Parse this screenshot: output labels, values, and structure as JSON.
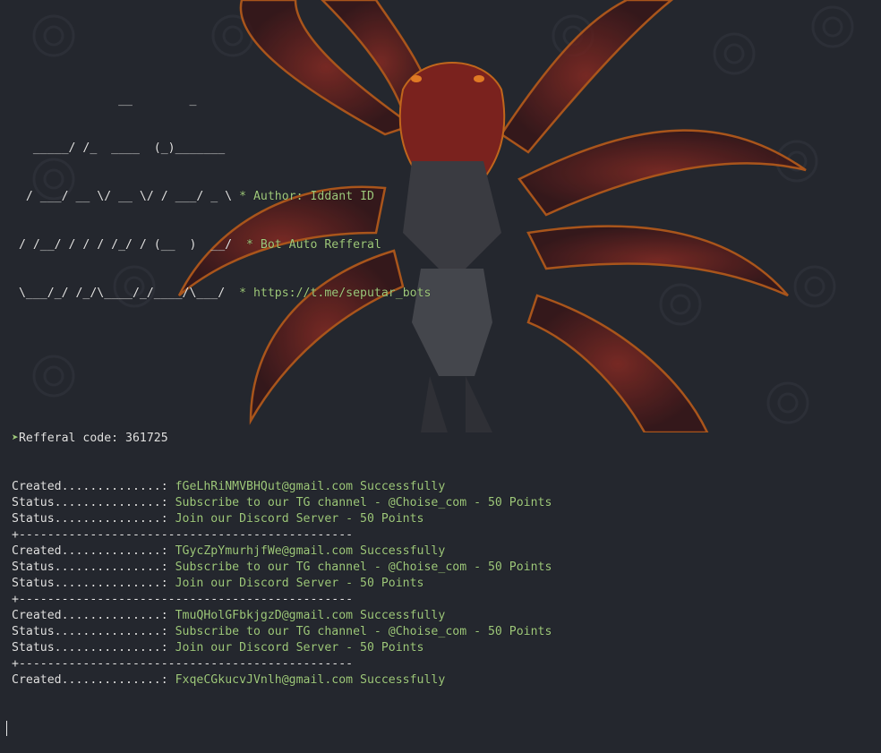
{
  "banner": {
    "art": [
      "               __        _",
      "   _____/ /_  ____  (_)_______",
      "  / ___/ __ \\/ __ \\/ / ___/ _ \\",
      " / /__/ / / / /_/ / (__  )  __/",
      " \\___/_/ /_/\\____/_/____/\\___/"
    ],
    "info": [
      "",
      "",
      "* Author: Iddant ID",
      "* Bot Auto Refferal",
      "* https://t.me/seputar_bots"
    ]
  },
  "referral": {
    "arrow": "➤",
    "text": "Refferal code: 361725"
  },
  "log": [
    {
      "label": "Created..............:",
      "value": "fGeLhRiNMVBHQut@gmail.com Successfully"
    },
    {
      "label": "Status...............:",
      "value": "Subscribe to our TG channel - @Choise_com - 50 Points"
    },
    {
      "label": "Status...............:",
      "value": "Join our Discord Server - 50 Points"
    },
    {
      "separator": "+-----------------------------------------------"
    },
    {
      "label": "Created..............:",
      "value": "TGycZpYmurhjfWe@gmail.com Successfully"
    },
    {
      "label": "Status...............:",
      "value": "Subscribe to our TG channel - @Choise_com - 50 Points"
    },
    {
      "label": "Status...............:",
      "value": "Join our Discord Server - 50 Points"
    },
    {
      "separator": "+-----------------------------------------------"
    },
    {
      "label": "Created..............:",
      "value": "TmuQHolGFbkjgzD@gmail.com Successfully"
    },
    {
      "label": "Status...............:",
      "value": "Subscribe to our TG channel - @Choise_com - 50 Points"
    },
    {
      "label": "Status...............:",
      "value": "Join our Discord Server - 50 Points"
    },
    {
      "separator": "+-----------------------------------------------"
    },
    {
      "label": "Created..............:",
      "value": "FxqeCGkucvJVnlh@gmail.com Successfully"
    }
  ],
  "colors": {
    "background": "#24272e",
    "text": "#e2e2e2",
    "green": "#9fc97c",
    "cape": "#6e1d1b",
    "outline": "#b85a1a"
  }
}
